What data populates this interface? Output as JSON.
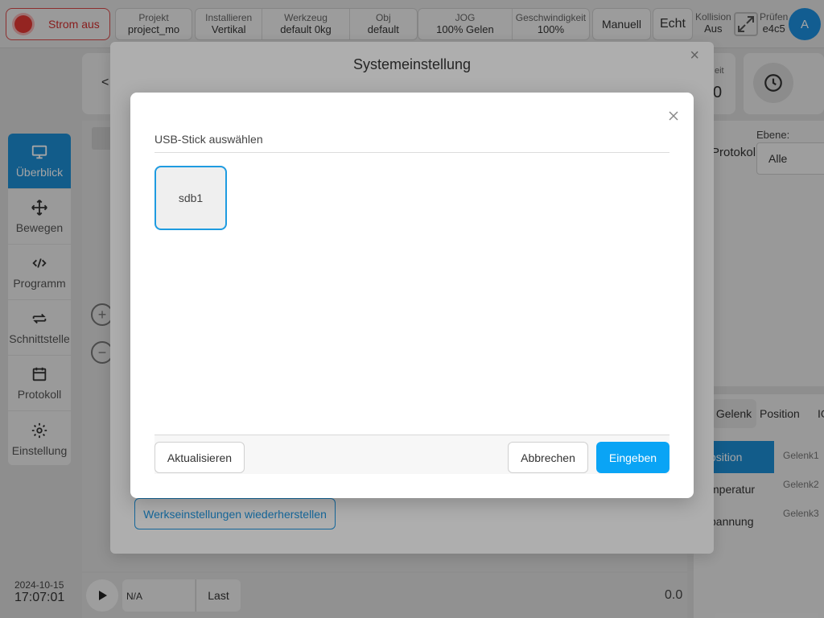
{
  "topbar": {
    "power_label": "Strom aus",
    "stats_a": [
      {
        "label": "Projekt",
        "value": "project_mo"
      },
      {
        "label": "Installieren",
        "value": "Vertikal"
      },
      {
        "label": "Werkzeug",
        "value": "default 0kg"
      },
      {
        "label": "Obj",
        "value": "default"
      },
      {
        "label": "JOG",
        "value": "100% Gelen"
      },
      {
        "label": "Geschwindigkeit",
        "value": "100%"
      }
    ],
    "mode_manual": "Manuell",
    "mode_real": "Echt",
    "collision_label": "Kollision",
    "collision_value": "Aus",
    "check_label": "Prüfen",
    "check_value": "e4c5",
    "avatar_letter": "A"
  },
  "sidebar": {
    "items": [
      {
        "label": "Überblick",
        "icon": "monitor-icon"
      },
      {
        "label": "Bewegen",
        "icon": "move-icon"
      },
      {
        "label": "Programm",
        "icon": "code-icon"
      },
      {
        "label": "Schnittstelle",
        "icon": "swap-icon"
      },
      {
        "label": "Protokoll",
        "icon": "calendar-icon"
      },
      {
        "label": "Einstellung",
        "icon": "gear-icon"
      }
    ]
  },
  "background": {
    "back_symbol": "<",
    "time_partial": "eit",
    "value_partial": "0",
    "log_label": "Protokoll",
    "ebene_label": "Ebene:",
    "ebene_value": "Alle",
    "tabs": [
      "Gelenk",
      "Position",
      "IO"
    ],
    "side_tabs": [
      "Position",
      "Temperatur",
      "Spannung"
    ],
    "side_tabs_visible": [
      "osition",
      "mperatur",
      "pannung"
    ],
    "joint_labels": [
      "Gelenk1",
      "Gelenk2",
      "Gelenk3"
    ],
    "program_name": "N/A",
    "last_label": "Last",
    "speed_value": "0.0",
    "date": "2024-10-15",
    "time": "17:07:01"
  },
  "system_dialog": {
    "title": "Systemeinstellung",
    "reset_label": "Werkseinstellungen wiederherstellen"
  },
  "usb_dialog": {
    "title": "USB-Stick auswählen",
    "devices": [
      "sdb1"
    ],
    "refresh_label": "Aktualisieren",
    "cancel_label": "Abbrechen",
    "confirm_label": "Eingeben"
  },
  "colors": {
    "accent": "#0aa4f5",
    "selection_border": "#1e9be0",
    "power_red": "#e53935"
  }
}
